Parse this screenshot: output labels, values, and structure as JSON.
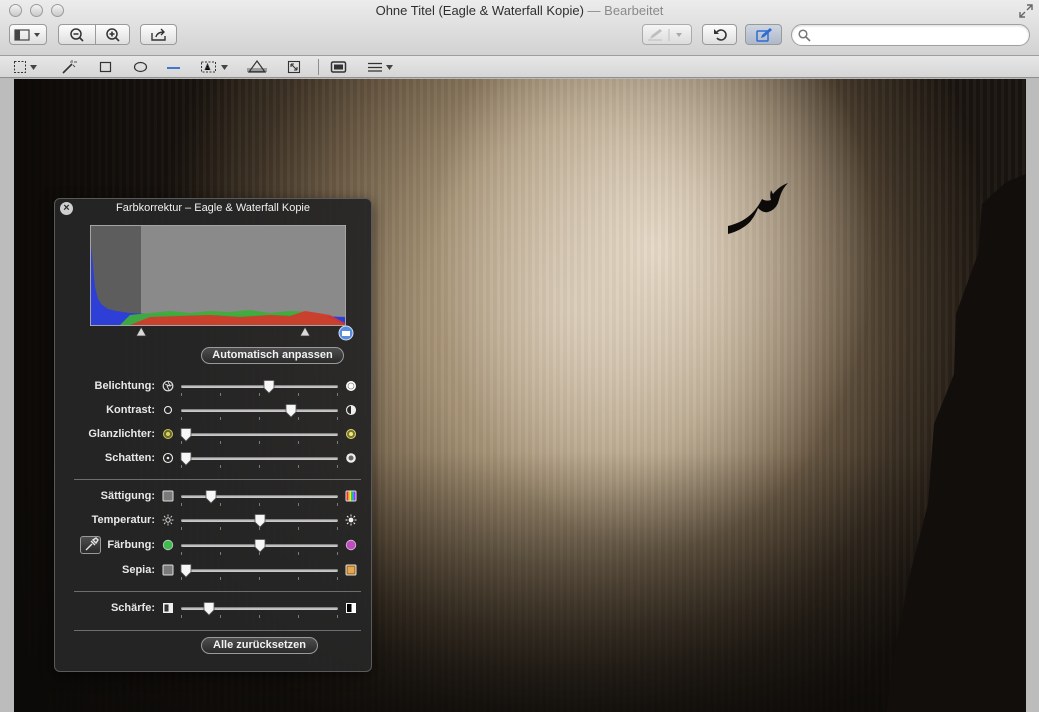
{
  "window": {
    "title": "Ohne Titel (Eagle & Waterfall Kopie)",
    "separator": " — ",
    "status": "Bearbeitet"
  },
  "toolbar": {
    "search": {
      "value": "",
      "placeholder": ""
    }
  },
  "icons": {
    "sidebar": "sidebar-icon",
    "zoom_out": "zoom-out-icon",
    "zoom_in": "zoom-in-icon",
    "share": "share-icon",
    "markup_pen": "pen-icon",
    "rotate": "rotate-icon",
    "edit_toolbar": "markup-toolbox-icon"
  },
  "colors": {
    "accent_blue": "#2e6cd1",
    "hud_bg": "#262626",
    "hist_red": "#d8352a",
    "hist_green": "#3fae3a",
    "hist_blue": "#2d3fd6"
  },
  "hud": {
    "title": "Farbkorrektur – Eagle & Waterfall Kopie",
    "auto_button": "Automatisch anpassen",
    "reset_button": "Alle zurücksetzen",
    "levels": {
      "black_point": 0.2,
      "mid_point": 0.84,
      "white_point": 1.0
    },
    "sliders": [
      {
        "key": "belichtung",
        "label": "Belichtung:",
        "value": 0.56,
        "left_icon": "aperture-icon",
        "right_icon": "bright-circle-icon"
      },
      {
        "key": "kontrast",
        "label": "Kontrast:",
        "value": 0.7,
        "left_icon": "circle-outline-icon",
        "right_icon": "half-circle-icon"
      },
      {
        "key": "glanzlichter",
        "label": "Glanzlichter:",
        "value": 0.03,
        "left_icon": "highlight-dim-icon",
        "right_icon": "highlight-bright-icon"
      },
      {
        "key": "schatten",
        "label": "Schatten:",
        "value": 0.03,
        "left_icon": "shadow-dot-icon",
        "right_icon": "shadow-filled-icon"
      },
      {
        "key": "saettigung",
        "label": "Sättigung:",
        "value": 0.19,
        "left_icon": "gray-square-icon",
        "right_icon": "rainbow-square-icon"
      },
      {
        "key": "temperatur",
        "label": "Temperatur:",
        "value": 0.5,
        "left_icon": "cool-sun-icon",
        "right_icon": "warm-sun-icon"
      },
      {
        "key": "faerbung",
        "label": "Färbung:",
        "value": 0.5,
        "left_icon": "green-dot-icon",
        "right_icon": "magenta-dot-icon"
      },
      {
        "key": "sepia",
        "label": "Sepia:",
        "value": 0.03,
        "left_icon": "gray-square-icon",
        "right_icon": "sepia-square-icon"
      },
      {
        "key": "schaerfe",
        "label": "Schärfe:",
        "value": 0.18,
        "left_icon": "soft-square-icon",
        "right_icon": "sharp-square-icon"
      }
    ]
  }
}
